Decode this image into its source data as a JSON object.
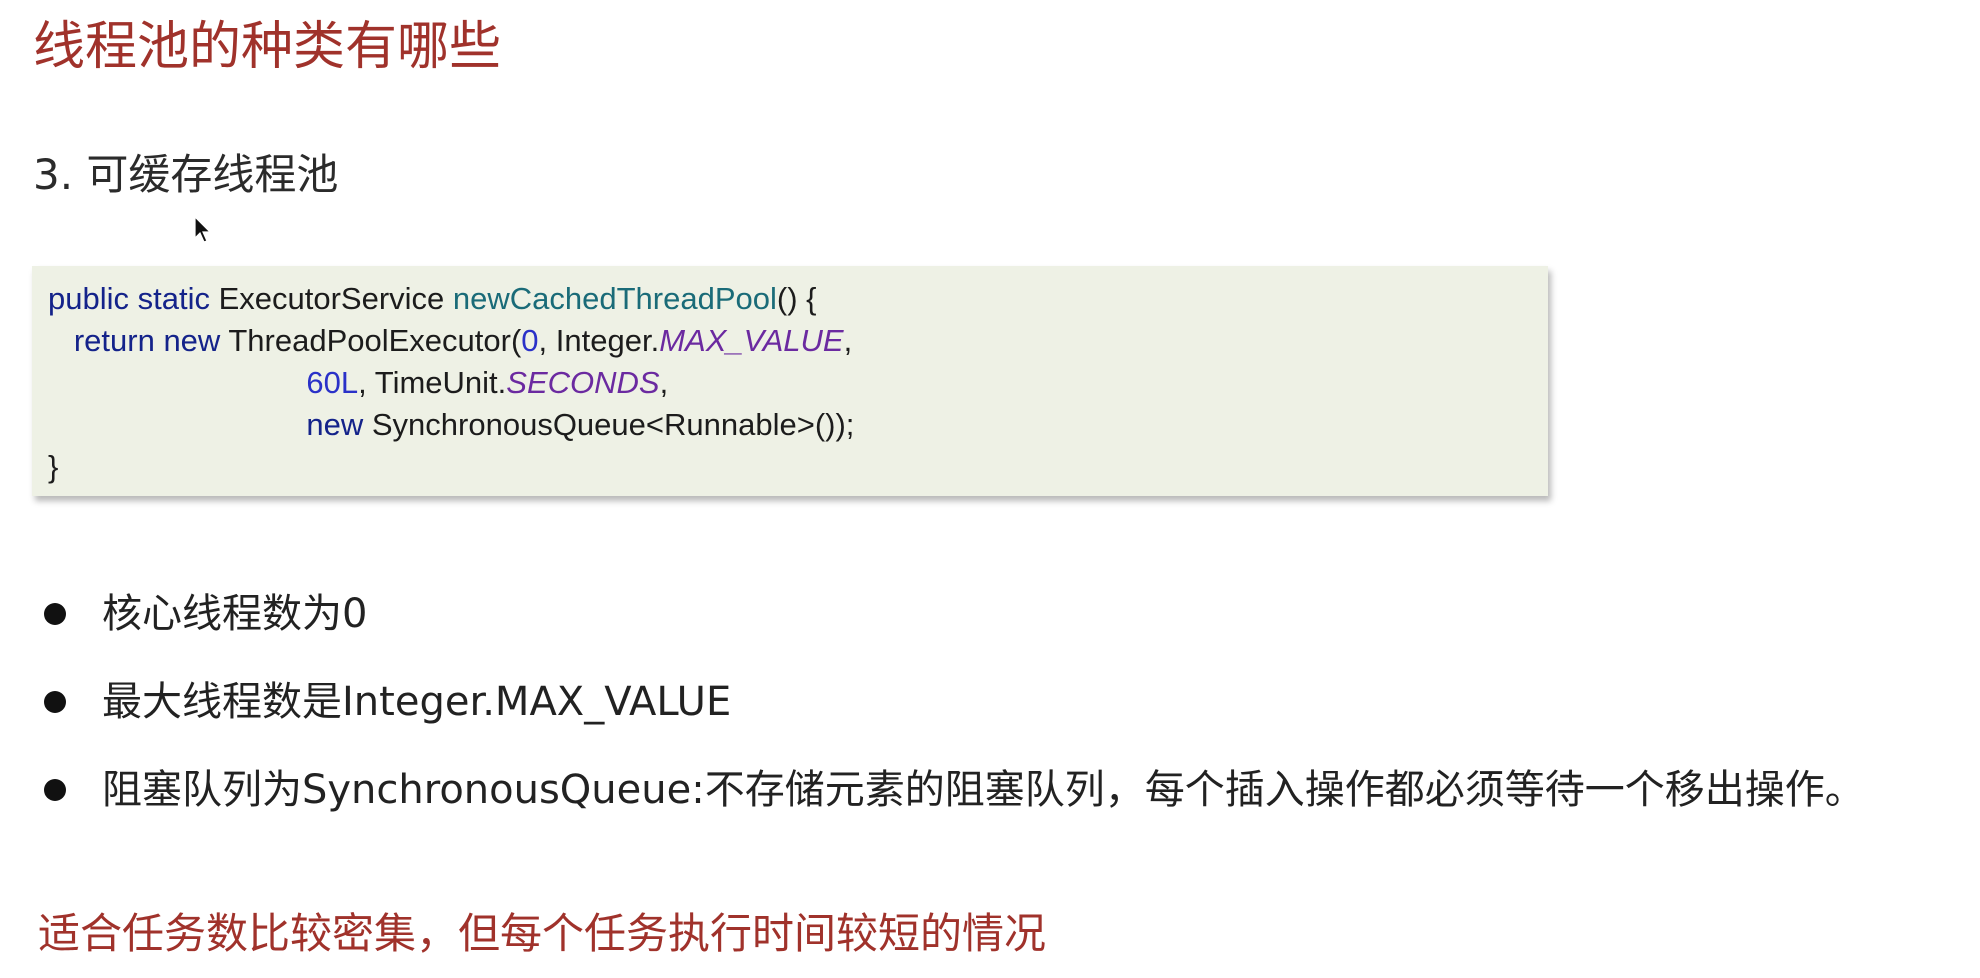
{
  "title": "线程池的种类有哪些",
  "section": {
    "heading": "3. 可缓存线程池"
  },
  "code": {
    "line1": {
      "kw1": "public static",
      "t1": " ExecutorService ",
      "fn1": "newCachedThreadPool",
      "t2": "() {"
    },
    "line2": {
      "indent": "   ",
      "kw1": "return new",
      "t1": " ThreadPoolExecutor(",
      "num1": "0",
      "t2": ", Integer.",
      "const1": "MAX_VALUE",
      "t3": ","
    },
    "line3": {
      "indent": "                              ",
      "num1": "60L",
      "t1": ", TimeUnit.",
      "const1": "SECONDS",
      "t2": ","
    },
    "line4": {
      "indent": "                              ",
      "kw1": "new",
      "t1": " SynchronousQueue<Runnable>());"
    },
    "line5": {
      "t1": "}"
    }
  },
  "bullets": [
    "核心线程数为0",
    "最大线程数是Integer.MAX_VALUE",
    "阻塞队列为SynchronousQueue:不存储元素的阻塞队列，每个插入操作都必须等待一个移出操作。"
  ],
  "conclusion": "适合任务数比较密集，但每个任务执行时间较短的情况",
  "icons": {
    "cursor": "mouse-pointer-icon"
  },
  "colors": {
    "title": "#a0322b",
    "code_background": "#eef1e5",
    "keyword": "#14238a",
    "method": "#1a6b78",
    "number": "#2a31c8",
    "constant": "#6b2aa0"
  }
}
